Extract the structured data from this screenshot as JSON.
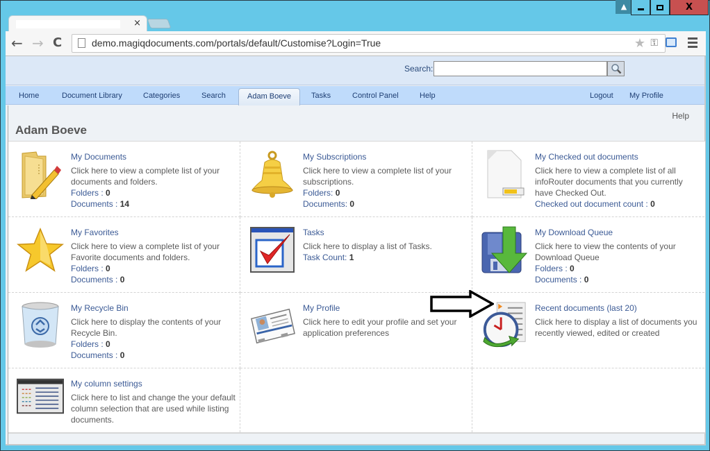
{
  "browser": {
    "tab_close": "×",
    "url": "demo.magiqdocuments.com/portals/default/Customise?Login=True",
    "back_glyph": "←",
    "forward_glyph": "→",
    "reload_glyph": "C",
    "star_glyph": "★",
    "key_glyph": "⚿",
    "close_glyph": "X",
    "user_glyph": "▲"
  },
  "header": {
    "search_label": "Search:",
    "search_value": "",
    "search_icon": "🔍"
  },
  "nav": {
    "items": [
      {
        "label": "Home"
      },
      {
        "label": "Document Library"
      },
      {
        "label": "Categories"
      },
      {
        "label": "Search"
      },
      {
        "label": "Adam Boeve",
        "active": true
      },
      {
        "label": "Tasks"
      },
      {
        "label": "Control Panel"
      },
      {
        "label": "Help"
      }
    ],
    "right_items": [
      {
        "label": "Logout"
      },
      {
        "label": "My Profile"
      }
    ]
  },
  "content": {
    "help_label": "Help",
    "page_title": "Adam Boeve",
    "cells": [
      {
        "icon": "folder-pencil-icon",
        "title": "My Documents",
        "desc": "Click here to view a complete list of your documents and folders.",
        "stats": [
          {
            "label": "Folders : ",
            "value": "0"
          },
          {
            "label": "Documents : ",
            "value": "14"
          }
        ]
      },
      {
        "icon": "bell-icon",
        "title": "My Subscriptions",
        "desc": "Click here to view a complete list of your subscriptions.",
        "stats": [
          {
            "label": "Folders: ",
            "value": "0"
          },
          {
            "label": "Documents: ",
            "value": "0"
          }
        ]
      },
      {
        "icon": "checked-out-document-icon",
        "title": "My Checked out documents",
        "desc": "Click here to view a complete list of all infoRouter documents that you currently have Checked Out.",
        "stats": [
          {
            "label": "Checked out document count : ",
            "value": "0"
          }
        ]
      },
      {
        "icon": "star-icon",
        "title": "My Favorites",
        "desc": "Click here to view a complete list of your Favorite documents and folders.",
        "stats": [
          {
            "label": "Folders : ",
            "value": "0"
          },
          {
            "label": "Documents : ",
            "value": "0"
          }
        ]
      },
      {
        "icon": "task-checkbox-icon",
        "title": "Tasks",
        "desc": "Click here to display a list of Tasks.",
        "stats": [
          {
            "label": "Task Count: ",
            "value": "1"
          }
        ]
      },
      {
        "icon": "download-queue-icon",
        "title": "My Download Queue",
        "desc": "Click here to view the contents of your Download Queue",
        "stats": [
          {
            "label": "Folders : ",
            "value": "0"
          },
          {
            "label": "Documents : ",
            "value": "0"
          }
        ]
      },
      {
        "icon": "recycle-bin-icon",
        "title": "My Recycle Bin",
        "desc": "Click here to display the contents of your Recycle Bin.",
        "stats": [
          {
            "label": "Folders : ",
            "value": "0"
          },
          {
            "label": "Documents : ",
            "value": "0"
          }
        ]
      },
      {
        "icon": "profile-card-icon",
        "title": "My Profile",
        "desc": "Click here to edit your profile and set your application preferences",
        "stats": []
      },
      {
        "icon": "recent-documents-clock-icon",
        "title": "Recent documents (last 20)",
        "desc": "Click here to display a list of documents you recently viewed, edited or created",
        "stats": []
      },
      {
        "icon": "column-settings-icon",
        "title": "My column settings",
        "desc": "Click here to list and change the your default column selection that are used while listing documents.",
        "stats": []
      }
    ]
  },
  "colors": {
    "window_frame": "#65c8e8",
    "nav_bar": "#bfdbfb",
    "header_band": "#dce8f7",
    "link": "#3b5a95",
    "close_button": "#c75050"
  }
}
